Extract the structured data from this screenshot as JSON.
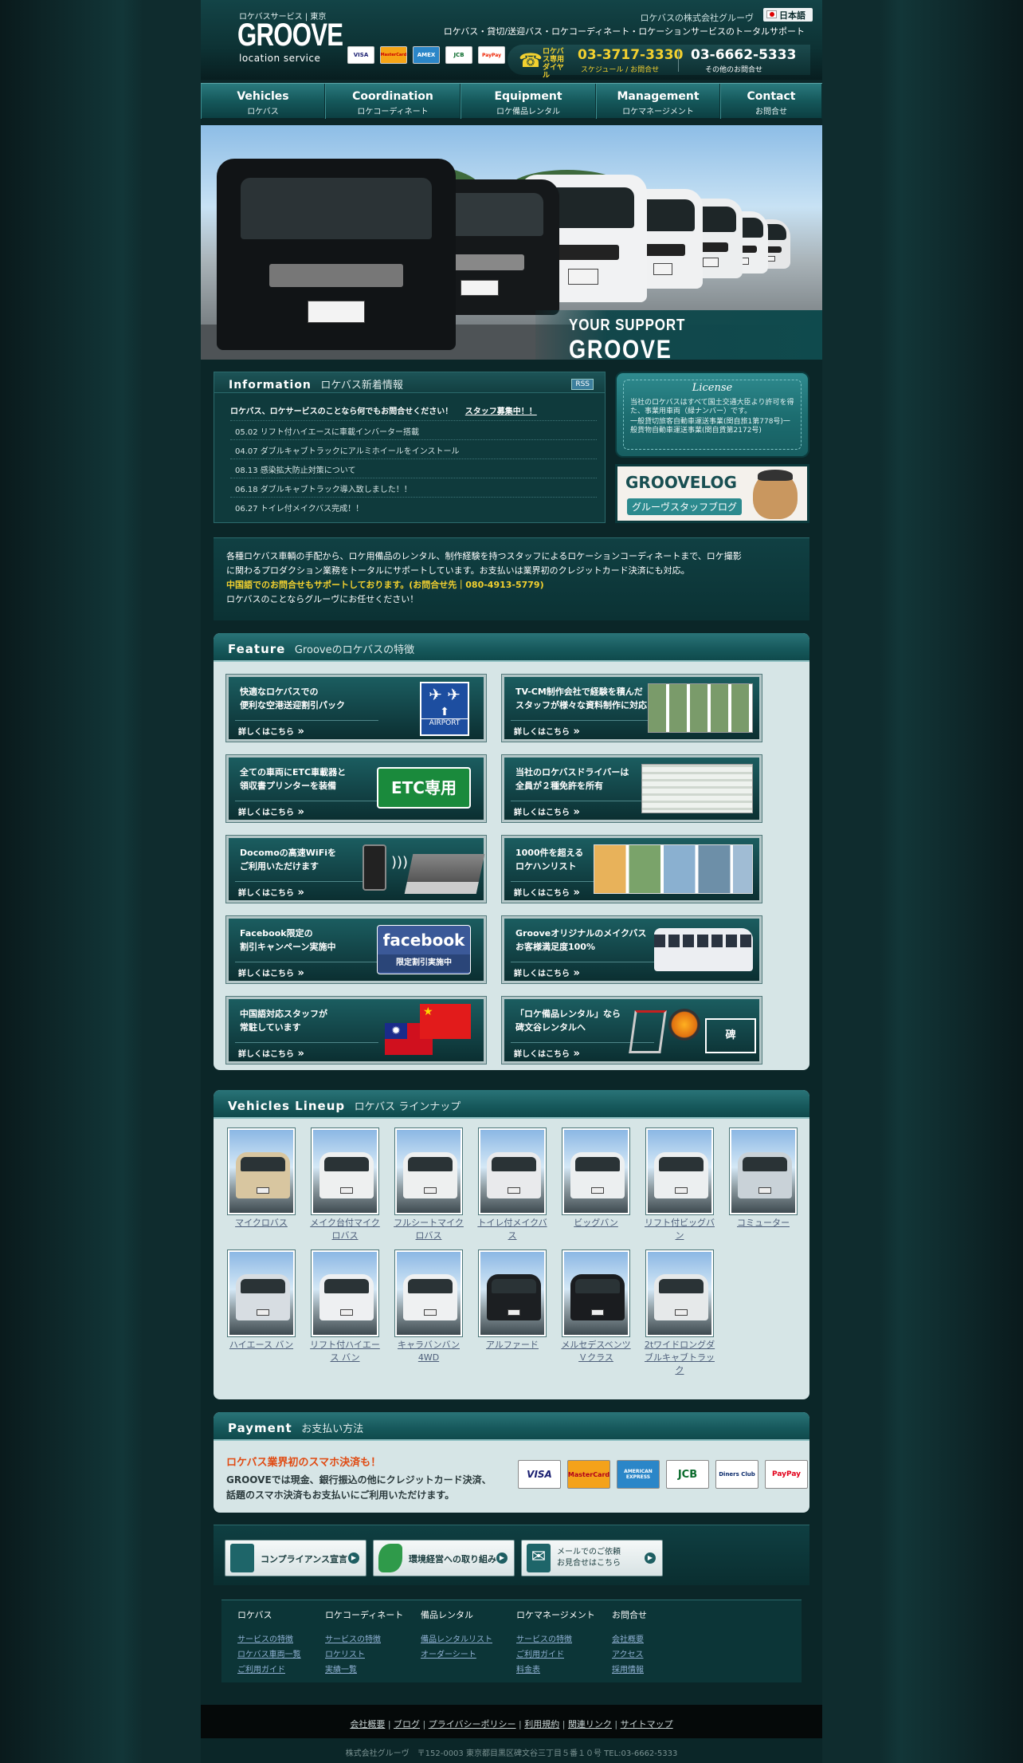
{
  "header": {
    "logo_sub": "ロケバスサービス | 東京",
    "logo": "GROOVE",
    "logo_tag": "location service",
    "company": "ロケバスの株式会社グルーヴ",
    "language": "日本語",
    "tagline": "ロケバス・貸切/送迎バス・ロケコーディネート・ロケーションサービスのトータルサポート",
    "cards": [
      "VISA",
      "MasterCard",
      "AMEX",
      "JCB",
      "PayPay"
    ],
    "tel_label": "ロケバス専用ダイヤル",
    "tel_main": "03-3717-3330",
    "tel_main_sub": "スケジュール / お問合せ",
    "tel_other": "03-6662-5333",
    "tel_other_sub": "その他のお問合せ"
  },
  "nav": [
    {
      "en": "Vehicles",
      "ja": "ロケバス"
    },
    {
      "en": "Coordination",
      "ja": "ロケコーディネート"
    },
    {
      "en": "Equipment",
      "ja": "ロケ備品レンタル"
    },
    {
      "en": "Management",
      "ja": "ロケマネージメント"
    },
    {
      "en": "Contact",
      "ja": "お問合せ"
    }
  ],
  "hero": {
    "slogan": "YOUR SUPPORT",
    "brand": "GROOVE"
  },
  "info": {
    "title_en": "Information",
    "title_ja": "ロケバス新着情報",
    "rss": "RSS",
    "lead": "ロケバス、ロケサービスのことなら何でもお問合せください！",
    "recruit": "スタッフ募集中！！",
    "news": [
      "05.02 リフト付ハイエースに車載インバーター搭載",
      "04.07 ダブルキャブトラックにアルミホイールをインストール",
      "08.13 感染拡大防止対策について",
      "06.18 ダブルキャブトラック導入致しました！！",
      "06.27 トイレ付メイクバス完成！！"
    ]
  },
  "license": {
    "title": "License",
    "text1": "当社のロケバスはすべて国土交通大臣より許可を得た、事業用車両（緑ナンバー）です。",
    "text2": "一般貸切旅客自動車運送事業(関自旅1第778号)一般貨物自動車運送事業(関自貨第2172号)"
  },
  "groovelog": {
    "title": "GROOVELOG",
    "sub": "グルーヴスタッフブログ"
  },
  "intro": {
    "line1": "各種ロケバス車輌の手配から、ロケ用備品のレンタル、制作経験を持つスタッフによるロケーションコーディネートまで、ロケ撮影",
    "line2": "に関わるプロダクション業務をトータルにサポートしています。お支払いは業界初のクレジットカード決済にも対応。",
    "line3": "中国語でのお問合せもサポートしております。(お問合せ先｜080-4913-5779)",
    "line4": "ロケバスのことならグルーヴにお任せください！"
  },
  "feature": {
    "title_en": "Feature",
    "title_ja": "Grooveのロケバスの特徴",
    "more": "詳しくはこちら",
    "items": [
      {
        "l1": "快適なロケバスでの",
        "l2": "便利な空港送迎割引パック",
        "art": "AIRPORT"
      },
      {
        "l1": "TV-CM制作会社で経験を積んだ",
        "l2": "スタッフが様々な資料制作に対応",
        "art": ""
      },
      {
        "l1": "全ての車両にETC車載器と",
        "l2": "領収書プリンターを装備",
        "art": "ETC専用"
      },
      {
        "l1": "当社のロケバスドライバーは",
        "l2": "全員が２種免許を所有",
        "art": ""
      },
      {
        "l1": "Docomoの高速WiFiを",
        "l2": "ご利用いただけます",
        "art": ""
      },
      {
        "l1": "1000件を超える",
        "l2": "ロケハンリスト",
        "art": ""
      },
      {
        "l1": "Facebook限定の",
        "l2": "割引キャンペーン実施中",
        "art": "facebook"
      },
      {
        "l1": "Grooveオリジナルのメイクバス",
        "l2": "お客様満足度100%",
        "art": ""
      },
      {
        "l1": "中国語対応スタッフが",
        "l2": "常駐しています",
        "art": ""
      },
      {
        "l1": "「ロケ備品レンタル」なら",
        "l2": "碑文谷レンタルへ",
        "art": ""
      }
    ],
    "fb_sub": "限定割引実施中"
  },
  "vehicles": {
    "title_en": "Vehicles Lineup",
    "title_ja": "ロケバス ラインナップ",
    "items": [
      {
        "name": "マイクロバス",
        "color": "#d8c6a0"
      },
      {
        "name": "メイク台付マイクロバス",
        "color": "#eef0f0"
      },
      {
        "name": "フルシートマイクロバス",
        "color": "#eef0f0"
      },
      {
        "name": "トイレ付メイクバス",
        "color": "#e9eaec"
      },
      {
        "name": "ビッグバン",
        "color": "#eceff0"
      },
      {
        "name": "リフト付ビッグバン",
        "color": "#eceff0"
      },
      {
        "name": "コミューター",
        "color": "#c9d2d8"
      },
      {
        "name": "ハイエース バン",
        "color": "#d7dde2"
      },
      {
        "name": "リフト付ハイエース バン",
        "color": "#eef0f2"
      },
      {
        "name": "キャラバンバン4WD",
        "color": "#eff1f2"
      },
      {
        "name": "アルファード",
        "color": "#1c1f22"
      },
      {
        "name": "メルセデスベンツＶクラス",
        "color": "#1a1c1f"
      },
      {
        "name": "2tワイドロングダブルキャブトラック",
        "color": "#e6e9ea"
      }
    ]
  },
  "payment": {
    "title_en": "Payment",
    "title_ja": "お支払い方法",
    "lead": "ロケバス業界初のスマホ決済も！",
    "text1": "GROOVEでは現金、銀行振込の他にクレジットカード決済、",
    "text2": "話題のスマホ決済もお支払いにご利用いただけます。",
    "cards": [
      "VISA",
      "MasterCard",
      "AMERICAN EXPRESS",
      "JCB",
      "Diners Club",
      "PayPay"
    ]
  },
  "buttons": {
    "compliance": "コンプライアンス宣言",
    "environment": "環境経営への取り組み",
    "mail1": "メールでのご依頼",
    "mail2": "お見合せはこちら"
  },
  "footer": {
    "cols": [
      {
        "title": "ロケバス",
        "links": [
          "サービスの特徴",
          "ロケバス車両一覧",
          "ご利用ガイド"
        ]
      },
      {
        "title": "ロケコーディネート",
        "links": [
          "サービスの特徴",
          "ロケリスト",
          "実績一覧"
        ]
      },
      {
        "title": "備品レンタル",
        "links": [
          "備品レンタルリスト",
          "オーダーシート"
        ]
      },
      {
        "title": "ロケマネージメント",
        "links": [
          "サービスの特徴",
          "ご利用ガイド",
          "料金表"
        ]
      },
      {
        "title": "お問合せ",
        "links": [
          "会社概要",
          "アクセス",
          "採用情報"
        ]
      }
    ],
    "bar": [
      "会社概要",
      "ブログ",
      "プライバシーポリシー",
      "利用規約",
      "関連リンク",
      "サイトマップ"
    ],
    "copyright": "株式会社グルーヴ　〒152-0003 東京都目黒区碑文谷三丁目５番１０号 TEL:03-6662-5333"
  },
  "colors": {
    "accent": "#f3d12f",
    "primary": "#134447",
    "alert": "#e04a12"
  }
}
